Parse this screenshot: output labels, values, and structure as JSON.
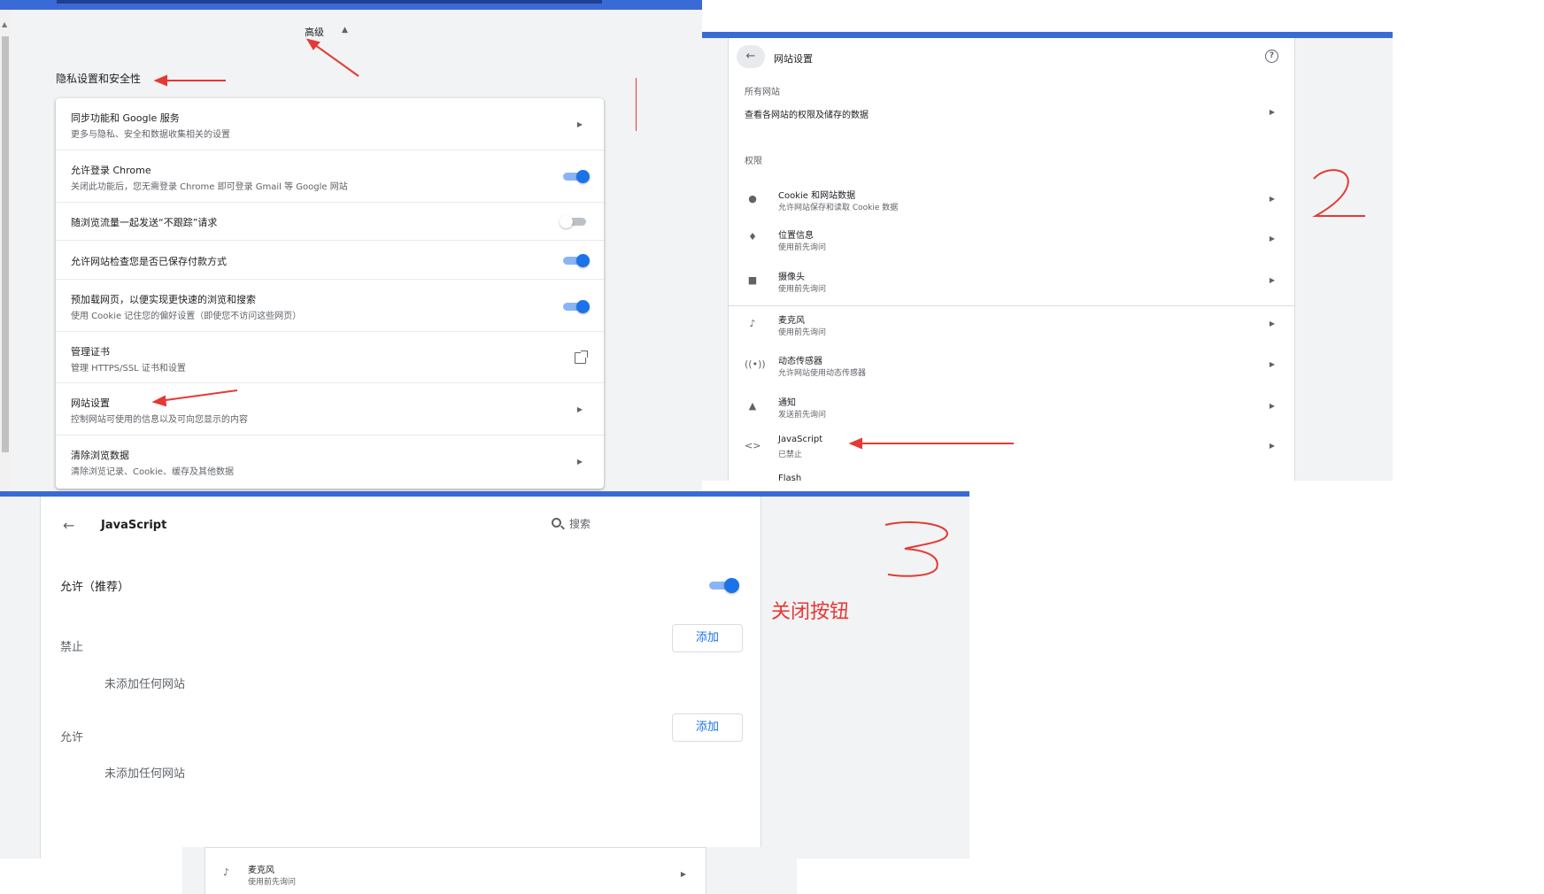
{
  "panel1": {
    "advanced_label": "高级",
    "section_title": "隐私设置和安全性",
    "rows": [
      {
        "title": "同步功能和 Google 服务",
        "subtitle": "更多与隐私、安全和数据收集相关的设置",
        "control": "arrow"
      },
      {
        "title": "允许登录 Chrome",
        "subtitle": "关闭此功能后，您无需登录 Chrome 即可登录 Gmail 等 Google 网站",
        "control": "toggle-on"
      },
      {
        "title": "随浏览流量一起发送“不跟踪”请求",
        "subtitle": "",
        "control": "toggle-off"
      },
      {
        "title": "允许网站检查您是否已保存付款方式",
        "subtitle": "",
        "control": "toggle-on"
      },
      {
        "title": "预加载网页，以便实现更快速的浏览和搜索",
        "subtitle": "使用 Cookie 记住您的偏好设置（即使您不访问这些网页）",
        "control": "toggle-on"
      },
      {
        "title": "管理证书",
        "subtitle": "管理 HTTPS/SSL 证书和设置",
        "control": "external"
      },
      {
        "title": "网站设置",
        "subtitle": "控制网站可使用的信息以及可向您显示的内容",
        "control": "arrow"
      },
      {
        "title": "清除浏览数据",
        "subtitle": "清除浏览记录、Cookie、缓存及其他数据",
        "control": "arrow"
      }
    ]
  },
  "panel2": {
    "title": "网站设置",
    "all_sites_label": "所有网站",
    "all_sites_row": "查看各网站的权限及储存的数据",
    "permissions_label": "权限",
    "rows": [
      {
        "icon": "cookie-icon",
        "title": "Cookie 和网站数据",
        "subtitle": "允许网站保存和读取 Cookie 数据"
      },
      {
        "icon": "location-icon",
        "title": "位置信息",
        "subtitle": "使用前先询问"
      },
      {
        "icon": "camera-icon",
        "title": "摄像头",
        "subtitle": "使用前先询问"
      },
      {
        "icon": "microphone-icon",
        "title": "麦克风",
        "subtitle": "使用前先询问"
      },
      {
        "icon": "motion-sensor-icon",
        "title": "动态传感器",
        "subtitle": "允许网站使用动态传感器"
      },
      {
        "icon": "bell-icon",
        "title": "通知",
        "subtitle": "发送前先询问"
      },
      {
        "icon": "code-icon",
        "title": "JavaScript",
        "subtitle": "已禁止"
      }
    ],
    "cut_row_title": "Flash"
  },
  "panel3": {
    "title": "JavaScript",
    "search_placeholder": "搜索",
    "allow_recommended": "允许（推荐）",
    "block_label": "禁止",
    "allow_label": "允许",
    "add_label": "添加",
    "empty_text": "未添加任何网站",
    "annotation_text": "关闭按钮"
  },
  "panel4": {
    "title": "麦克风",
    "subtitle": "使用前先询问"
  },
  "colors": {
    "accent": "#1a73e8",
    "bar": "#3a6ad6",
    "annotation": "#e53935"
  }
}
